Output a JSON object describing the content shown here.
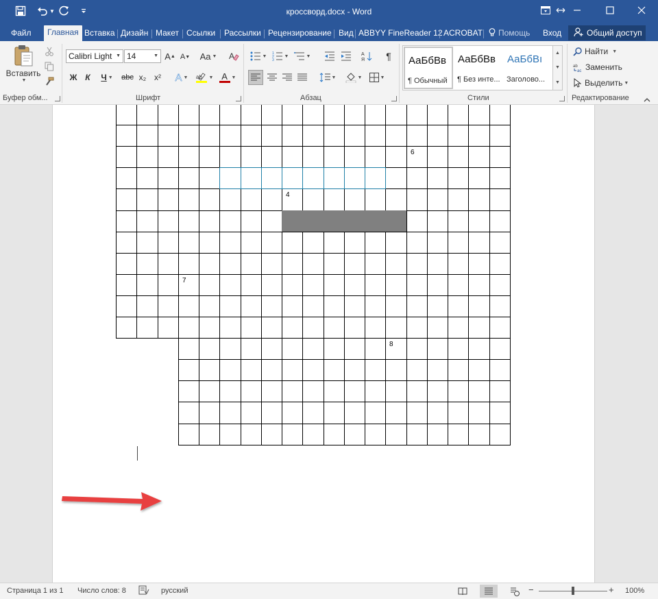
{
  "title_bar": {
    "document_title": "кроссворд.docx - Word",
    "quick_access": [
      "save-icon",
      "undo-icon",
      "redo-icon",
      "customize-icon"
    ],
    "window_controls": [
      "ribbon-display-icon",
      "resize-icon",
      "minimize-icon",
      "maximize-icon",
      "close-icon"
    ]
  },
  "tabs": [
    {
      "label": "Файл",
      "active": false
    },
    {
      "label": "Главная",
      "active": true
    },
    {
      "label": "Вставка",
      "active": false
    },
    {
      "label": "Дизайн",
      "active": false
    },
    {
      "label": "Макет",
      "active": false
    },
    {
      "label": "Ссылки",
      "active": false
    },
    {
      "label": "Рассылки",
      "active": false
    },
    {
      "label": "Рецензирование",
      "active": false
    },
    {
      "label": "Вид",
      "active": false
    },
    {
      "label": "ABBYY FineReader 12",
      "active": false
    },
    {
      "label": "ACROBAT",
      "active": false
    },
    {
      "label": "Помощь",
      "active": false
    },
    {
      "label": "Вход",
      "active": false
    }
  ],
  "share_label": "Общий доступ",
  "ribbon": {
    "clipboard": {
      "paste_label": "Вставить",
      "group_label": "Буфер обм..."
    },
    "font": {
      "font_name": "Calibri Light",
      "font_size": "14",
      "change_case_label": "Aa",
      "grow_label": "A",
      "shrink_label": "A",
      "bold": "Ж",
      "italic": "К",
      "underline": "Ч",
      "strike": "abc",
      "subscript": "x₂",
      "superscript": "x²",
      "effects_label": "A",
      "font_color_label": "A",
      "group_label": "Шрифт"
    },
    "paragraph": {
      "pilcrow": "¶",
      "group_label": "Абзац"
    },
    "styles": {
      "items": [
        {
          "sample": "АаБбВв",
          "name": "¶ Обычный",
          "selected": true
        },
        {
          "sample": "АаБбВв",
          "name": "¶ Без инте...",
          "selected": false
        },
        {
          "sample": "АаБбВı",
          "name": "Заголово...",
          "selected": false
        }
      ],
      "group_label": "Стили"
    },
    "editing": {
      "find": "Найти",
      "replace": "Заменить",
      "select": "Выделить",
      "group_label": "Редактирование"
    }
  },
  "crossword": {
    "rows": [
      {
        "start": 0,
        "end": 19
      },
      {
        "start": 0,
        "end": 19
      },
      {
        "start": 0,
        "end": 19
      },
      {
        "start": 0,
        "end": 19
      },
      {
        "start": 0,
        "end": 19
      },
      {
        "start": 0,
        "end": 19
      },
      {
        "start": 0,
        "end": 19
      },
      {
        "start": 0,
        "end": 19
      },
      {
        "start": 0,
        "end": 19
      },
      {
        "start": 0,
        "end": 19
      },
      {
        "start": 0,
        "end": 19
      },
      {
        "start": 3,
        "end": 19
      },
      {
        "start": 3,
        "end": 19
      },
      {
        "start": 3,
        "end": 19
      },
      {
        "start": 3,
        "end": 19
      },
      {
        "start": 3,
        "end": 19
      }
    ],
    "highlighted": {
      "row": 3,
      "col_start": 5,
      "col_end": 13
    },
    "shaded": {
      "row": 5,
      "col_start": 8,
      "col_end": 14
    },
    "numbers": [
      {
        "row": 2,
        "col": 14,
        "label": "6"
      },
      {
        "row": 4,
        "col": 8,
        "label": "4"
      },
      {
        "row": 8,
        "col": 3,
        "label": "7"
      },
      {
        "row": 11,
        "col": 13,
        "label": "8"
      }
    ]
  },
  "annotation": {
    "arrow_color": "#e84040"
  },
  "status_bar": {
    "page": "Страница 1 из 1",
    "words": "Число слов: 8",
    "language": "русский",
    "zoom": "100%",
    "zoom_level": 0.5
  },
  "colors": {
    "accent": "#2b579a",
    "highlight_border": "#1f7fa6",
    "shaded_cell": "#808080"
  }
}
